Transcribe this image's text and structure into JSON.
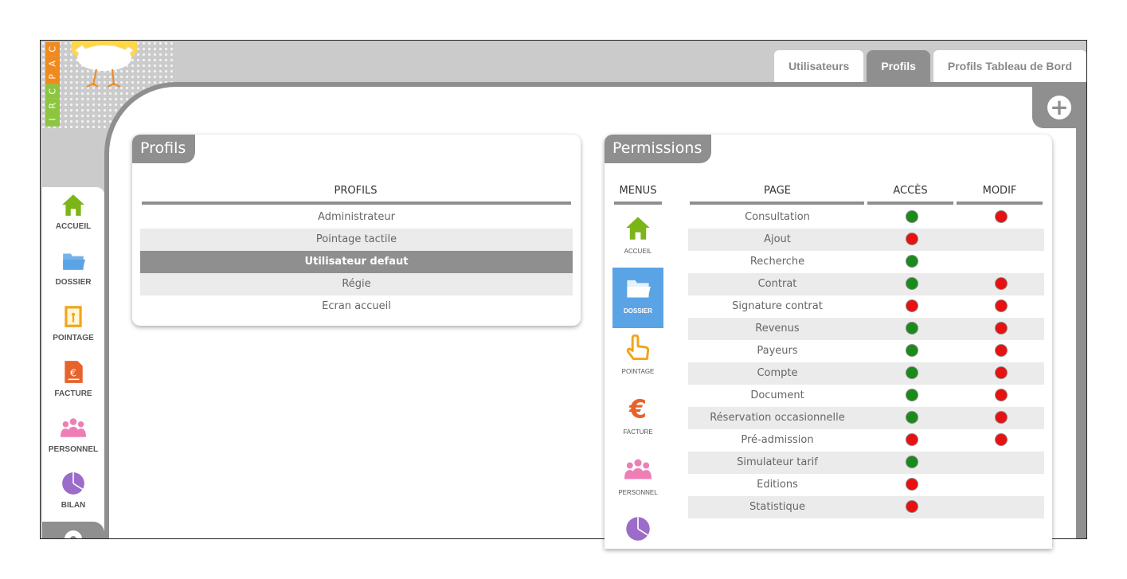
{
  "brand": {
    "letters": [
      "C",
      "A",
      "P",
      "C",
      "R",
      "I"
    ],
    "colors": [
      "#f08a1e",
      "#f08a1e",
      "#f08a1e",
      "#8cc63f",
      "#8cc63f",
      "#8cc63f"
    ]
  },
  "tabs": [
    {
      "label": "Utilisateurs",
      "active": false
    },
    {
      "label": "Profils",
      "active": true
    },
    {
      "label": "Profils Tableau de Bord",
      "active": false
    }
  ],
  "add_icon": "plus-circle-icon",
  "nav": [
    {
      "label": "ACCUEIL",
      "icon": "home-icon",
      "color": "#7cb518"
    },
    {
      "label": "DOSSIER",
      "icon": "folder-icon",
      "color": "#5aa4e6"
    },
    {
      "label": "POINTAGE",
      "icon": "door-icon",
      "color": "#f2a51c"
    },
    {
      "label": "FACTURE",
      "icon": "invoice-icon",
      "color": "#e8622c"
    },
    {
      "label": "PERSONNEL",
      "icon": "people-icon",
      "color": "#ee7eb6"
    },
    {
      "label": "BILAN",
      "icon": "pie-chart-icon",
      "color": "#9b6cc9"
    }
  ],
  "profils": {
    "title": "Profils",
    "header": "PROFILS",
    "rows": [
      {
        "label": "Administrateur",
        "selected": false
      },
      {
        "label": "Pointage tactile",
        "selected": false
      },
      {
        "label": "Utilisateur defaut",
        "selected": true
      },
      {
        "label": "Régie",
        "selected": false
      },
      {
        "label": "Ecran accueil",
        "selected": false
      }
    ]
  },
  "permissions": {
    "title": "Permissions",
    "headers": {
      "menus": "MENUS",
      "page": "PAGE",
      "acces": "ACCÈS",
      "modif": "MODIF"
    },
    "menus": [
      {
        "label": "ACCUEIL",
        "icon": "home-icon",
        "color": "#7cb518",
        "active": false
      },
      {
        "label": "DOSSIER",
        "icon": "folder-icon",
        "color": "#ffffff",
        "active": true
      },
      {
        "label": "POINTAGE",
        "icon": "pointing-hand-icon",
        "color": "#f2a51c",
        "active": false
      },
      {
        "label": "FACTURE",
        "icon": "euro-icon",
        "color": "#e8622c",
        "active": false
      },
      {
        "label": "PERSONNEL",
        "icon": "people-icon",
        "color": "#ee7eb6",
        "active": false
      },
      {
        "label": "",
        "icon": "pie-chart-icon",
        "color": "#9b6cc9",
        "active": false
      }
    ],
    "rows": [
      {
        "page": "Consultation",
        "acces": "green",
        "modif": "red"
      },
      {
        "page": "Ajout",
        "acces": "red",
        "modif": null
      },
      {
        "page": "Recherche",
        "acces": "green",
        "modif": null
      },
      {
        "page": "Contrat",
        "acces": "green",
        "modif": "red"
      },
      {
        "page": "Signature contrat",
        "acces": "red",
        "modif": "red"
      },
      {
        "page": "Revenus",
        "acces": "green",
        "modif": "red"
      },
      {
        "page": "Payeurs",
        "acces": "green",
        "modif": "red"
      },
      {
        "page": "Compte",
        "acces": "green",
        "modif": "red"
      },
      {
        "page": "Document",
        "acces": "green",
        "modif": "red"
      },
      {
        "page": "Réservation occasionnelle",
        "acces": "green",
        "modif": "red"
      },
      {
        "page": "Pré-admission",
        "acces": "red",
        "modif": "red"
      },
      {
        "page": "Simulateur tarif",
        "acces": "green",
        "modif": null
      },
      {
        "page": "Editions",
        "acces": "red",
        "modif": null
      },
      {
        "page": "Statistique",
        "acces": "red",
        "modif": null
      }
    ]
  }
}
